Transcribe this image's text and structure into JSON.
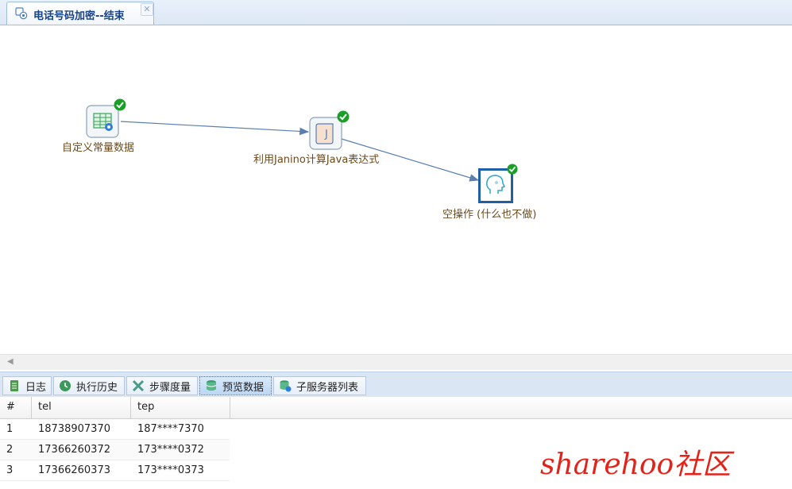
{
  "document_tab": {
    "title": "电话号码加密--结束",
    "icon": "transformation-icon",
    "close_icon": "close-icon"
  },
  "canvas": {
    "steps": [
      {
        "label": "自定义常量数据",
        "icon": "constant-data-table-icon",
        "status": "ok"
      },
      {
        "label": "利用Janino计算Java表达式",
        "icon": "java-script-scroll-icon",
        "status": "ok"
      },
      {
        "label": "空操作 (什么也不做)",
        "icon": "dummy-head-icon",
        "status": "ok",
        "selected": true
      }
    ],
    "hops": [
      {
        "from": "自定义常量数据",
        "to": "利用Janino计算Java表达式"
      },
      {
        "from": "利用Janino计算Java表达式",
        "to": "空操作 (什么也不做)"
      }
    ],
    "colors": {
      "label": "#6b4a1c",
      "hop": "#5a7fb0",
      "ok": "#1aa028",
      "selected_border": "#1f5fa6"
    }
  },
  "bottom_tabs": [
    {
      "label": "日志",
      "icon": "log-icon"
    },
    {
      "label": "执行历史",
      "icon": "history-icon"
    },
    {
      "label": "步骤度量",
      "icon": "step-metrics-icon"
    },
    {
      "label": "预览数据",
      "icon": "preview-data-icon",
      "active": true
    },
    {
      "label": "子服务器列表",
      "icon": "slave-servers-icon"
    }
  ],
  "preview_table": {
    "columns": [
      "#",
      "tel",
      "tep"
    ],
    "rows": [
      [
        "1",
        "18738907370",
        "187****7370"
      ],
      [
        "2",
        "17366260372",
        "173****0372"
      ],
      [
        "3",
        "17366260373",
        "173****0373"
      ]
    ]
  },
  "watermark": {
    "text": "sharehoo社区",
    "color": "#e2231a"
  }
}
